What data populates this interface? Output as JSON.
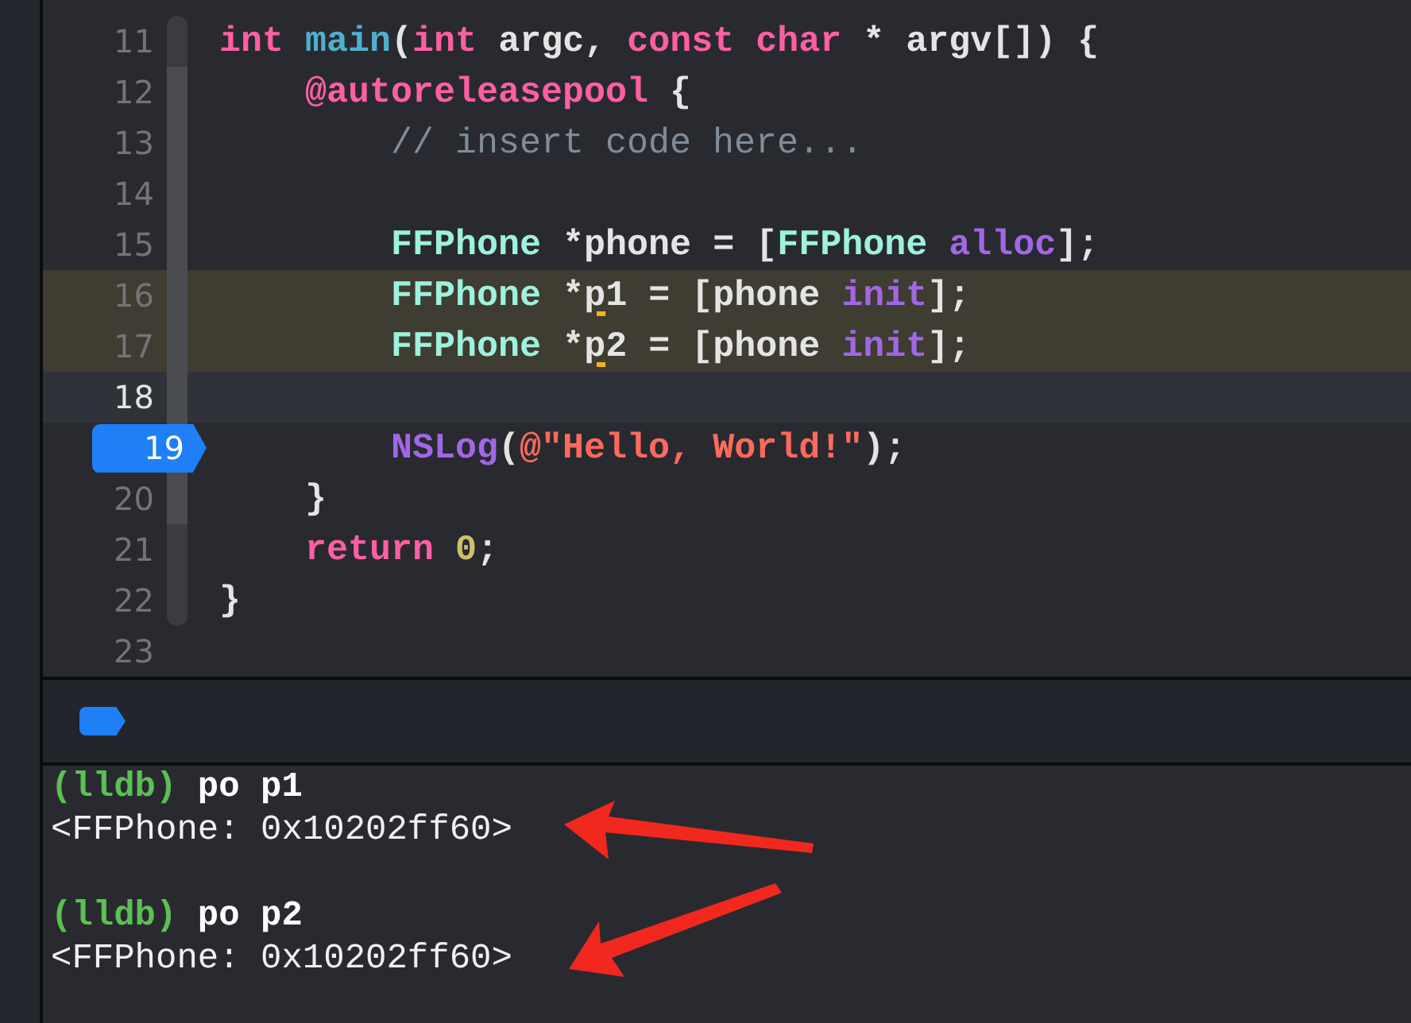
{
  "editor": {
    "lines": [
      {
        "number": "11",
        "highlighted": false,
        "current": false,
        "breakpoint": false,
        "tokens": [
          {
            "t": "int",
            "kind": "keyword"
          },
          {
            "t": " main",
            "kind": "function"
          },
          {
            "t": "(",
            "kind": "plain"
          },
          {
            "t": "int",
            "kind": "keyword"
          },
          {
            "t": " argc,",
            "kind": "plain"
          },
          {
            "t": " const",
            "kind": "keyword"
          },
          {
            "t": " char",
            "kind": "keyword"
          },
          {
            "t": " * argv[]) {",
            "kind": "plain"
          }
        ]
      },
      {
        "number": "12",
        "highlighted": false,
        "current": false,
        "breakpoint": false,
        "tokens": [
          {
            "t": "    @autoreleasepool",
            "kind": "keyword"
          },
          {
            "t": " {",
            "kind": "plain"
          }
        ]
      },
      {
        "number": "13",
        "highlighted": false,
        "current": false,
        "breakpoint": false,
        "tokens": [
          {
            "t": "        // insert code here...",
            "kind": "comment"
          }
        ]
      },
      {
        "number": "14",
        "highlighted": false,
        "current": false,
        "breakpoint": false
      },
      {
        "number": "15",
        "highlighted": false,
        "current": false,
        "breakpoint": false,
        "tokens": [
          {
            "t": "        FFPhone",
            "kind": "type"
          },
          {
            "t": " *phone = [",
            "kind": "plain"
          },
          {
            "t": "FFPhone",
            "kind": "type"
          },
          {
            "t": " alloc",
            "kind": "method"
          },
          {
            "t": "];",
            "kind": "plain"
          }
        ]
      },
      {
        "number": "16",
        "highlighted": true,
        "current": false,
        "breakpoint": false,
        "tokens": [
          {
            "t": "        FFPhone",
            "kind": "type"
          },
          {
            "t": " *",
            "kind": "plain"
          },
          {
            "t": "p",
            "kind": "warning"
          },
          {
            "t": "1 = [phone",
            "kind": "plain"
          },
          {
            "t": " init",
            "kind": "method"
          },
          {
            "t": "];",
            "kind": "plain"
          }
        ]
      },
      {
        "number": "17",
        "highlighted": true,
        "current": false,
        "breakpoint": false,
        "tokens": [
          {
            "t": "        FFPhone",
            "kind": "type"
          },
          {
            "t": " *",
            "kind": "plain"
          },
          {
            "t": "p",
            "kind": "warning"
          },
          {
            "t": "2 = [phone",
            "kind": "plain"
          },
          {
            "t": " init",
            "kind": "method"
          },
          {
            "t": "];",
            "kind": "plain"
          }
        ]
      },
      {
        "number": "18",
        "highlighted": false,
        "current": true,
        "breakpoint": false
      },
      {
        "number": "19",
        "highlighted": false,
        "current": false,
        "breakpoint": true,
        "tokens": [
          {
            "t": "        NSLog",
            "kind": "macro"
          },
          {
            "t": "(",
            "kind": "plain"
          },
          {
            "t": "@\"Hello, World!\"",
            "kind": "string"
          },
          {
            "t": ");",
            "kind": "plain"
          }
        ]
      },
      {
        "number": "20",
        "highlighted": false,
        "current": false,
        "breakpoint": false,
        "tokens": [
          {
            "t": "    }",
            "kind": "plain"
          }
        ]
      },
      {
        "number": "21",
        "highlighted": false,
        "current": false,
        "breakpoint": false,
        "tokens": [
          {
            "t": "    return",
            "kind": "keyword"
          },
          {
            "t": " 0",
            "kind": "number"
          },
          {
            "t": ";",
            "kind": "plain"
          }
        ]
      },
      {
        "number": "22",
        "highlighted": false,
        "current": false,
        "breakpoint": false,
        "tokens": [
          {
            "t": "}",
            "kind": "plain"
          }
        ]
      },
      {
        "number": "23",
        "highlighted": false,
        "current": false,
        "breakpoint": false
      }
    ]
  },
  "debug_bar": {
    "breakpoints_active": true
  },
  "console": {
    "lines": [
      {
        "kind": "prompt",
        "prompt": "(lldb)",
        "command": "po p1"
      },
      {
        "kind": "output",
        "text": "<FFPhone: 0x10202ff60>"
      },
      {
        "kind": "blank"
      },
      {
        "kind": "prompt",
        "prompt": "(lldb)",
        "command": "po p2"
      },
      {
        "kind": "output",
        "text": "<FFPhone: 0x10202ff60>"
      }
    ]
  }
}
